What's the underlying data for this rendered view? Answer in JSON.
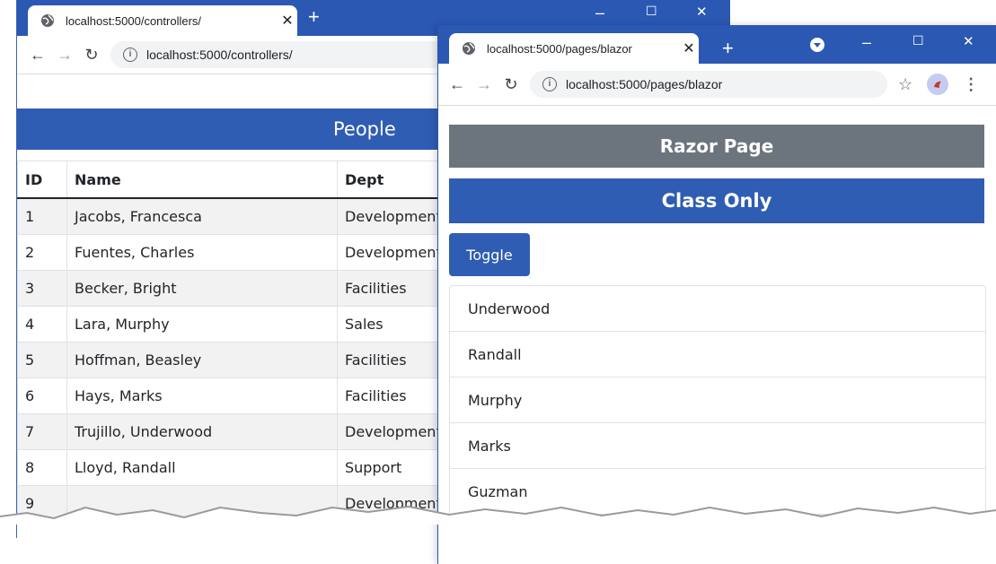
{
  "back_window": {
    "tab_title": "localhost:5000/controllers/",
    "tab_close": "✕",
    "new_tab": "+",
    "controls": {
      "minimize": "–",
      "maximize": "☐",
      "close": "✕"
    },
    "url": "localhost:5000/controllers/",
    "page": {
      "heading": "People",
      "columns": [
        "ID",
        "Name",
        "Dept"
      ],
      "rows": [
        [
          "1",
          "Jacobs, Francesca",
          "Development"
        ],
        [
          "2",
          "Fuentes, Charles",
          "Development"
        ],
        [
          "3",
          "Becker, Bright",
          "Facilities"
        ],
        [
          "4",
          "Lara, Murphy",
          "Sales"
        ],
        [
          "5",
          "Hoffman, Beasley",
          "Facilities"
        ],
        [
          "6",
          "Hays, Marks",
          "Facilities"
        ],
        [
          "7",
          "Trujillo, Underwood",
          "Development"
        ],
        [
          "8",
          "Lloyd, Randall",
          "Support"
        ],
        [
          "9",
          "",
          "Development"
        ]
      ]
    }
  },
  "front_window": {
    "tab_title": "localhost:5000/pages/blazor",
    "tab_close": "✕",
    "new_tab": "+",
    "controls": {
      "minimize": "–",
      "maximize": "☐",
      "close": "✕"
    },
    "url": "localhost:5000/pages/blazor",
    "page": {
      "razor_banner": "Razor Page",
      "class_banner": "Class Only",
      "toggle_label": "Toggle",
      "names": [
        "Underwood",
        "Randall",
        "Murphy",
        "Marks",
        "Guzman"
      ]
    }
  },
  "colors": {
    "titlebar": "#2b58b2",
    "primary": "#2f5db3",
    "secondary": "#6c757d"
  },
  "icons": [
    "globe-icon",
    "back-arrow-icon",
    "forward-arrow-icon",
    "reload-icon",
    "info-icon",
    "star-icon",
    "avatar-icon",
    "menu-icon",
    "profile-icon"
  ]
}
